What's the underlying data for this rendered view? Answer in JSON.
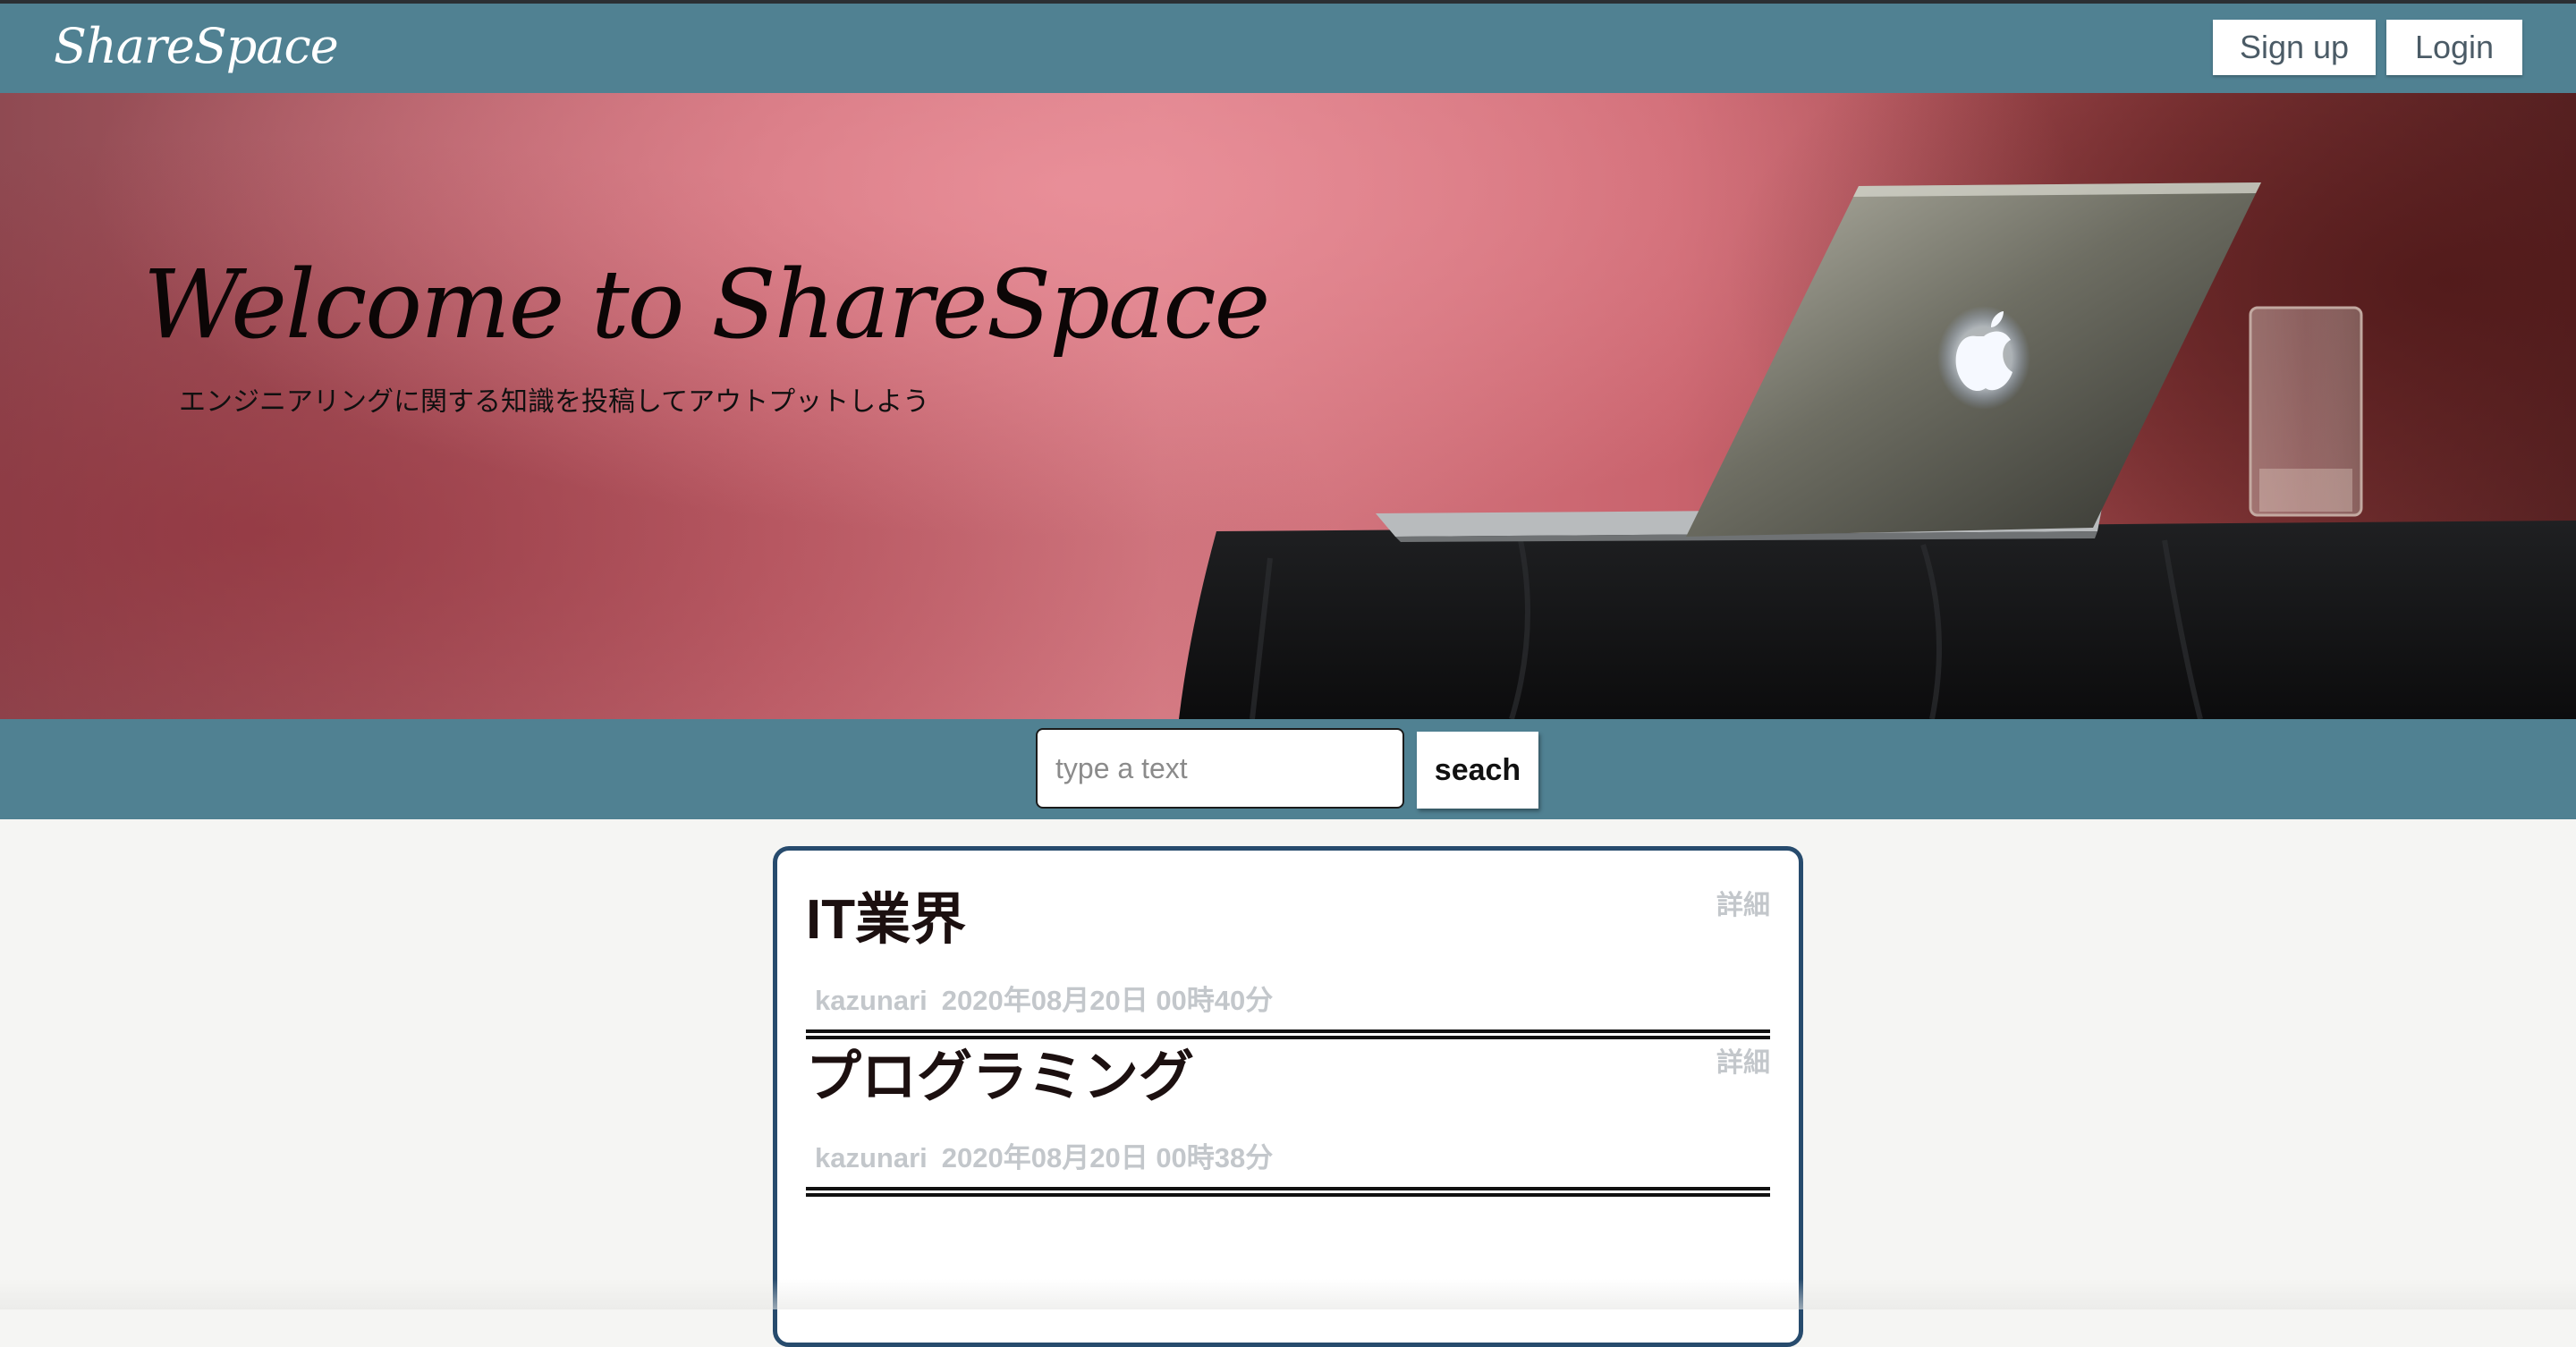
{
  "header": {
    "brand": "ShareSpace",
    "signup_label": "Sign up",
    "login_label": "Login"
  },
  "hero": {
    "title": "Welcome to ShareSpace",
    "subtitle": "エンジニアリングに関する知識を投稿してアウトプットしよう"
  },
  "search": {
    "placeholder": "type a text",
    "button_label": "seach"
  },
  "posts": [
    {
      "title": "IT業界",
      "author": "kazunari",
      "date": "2020年08月20日 00時40分",
      "detail_label": "詳細"
    },
    {
      "title": "プログラミング",
      "author": "kazunari",
      "date": "2020年08月20日 00時38分",
      "detail_label": "詳細"
    }
  ],
  "colors": {
    "header_bg": "#508192",
    "card_border": "#274b6d",
    "meta_text": "#c3c7cb"
  }
}
